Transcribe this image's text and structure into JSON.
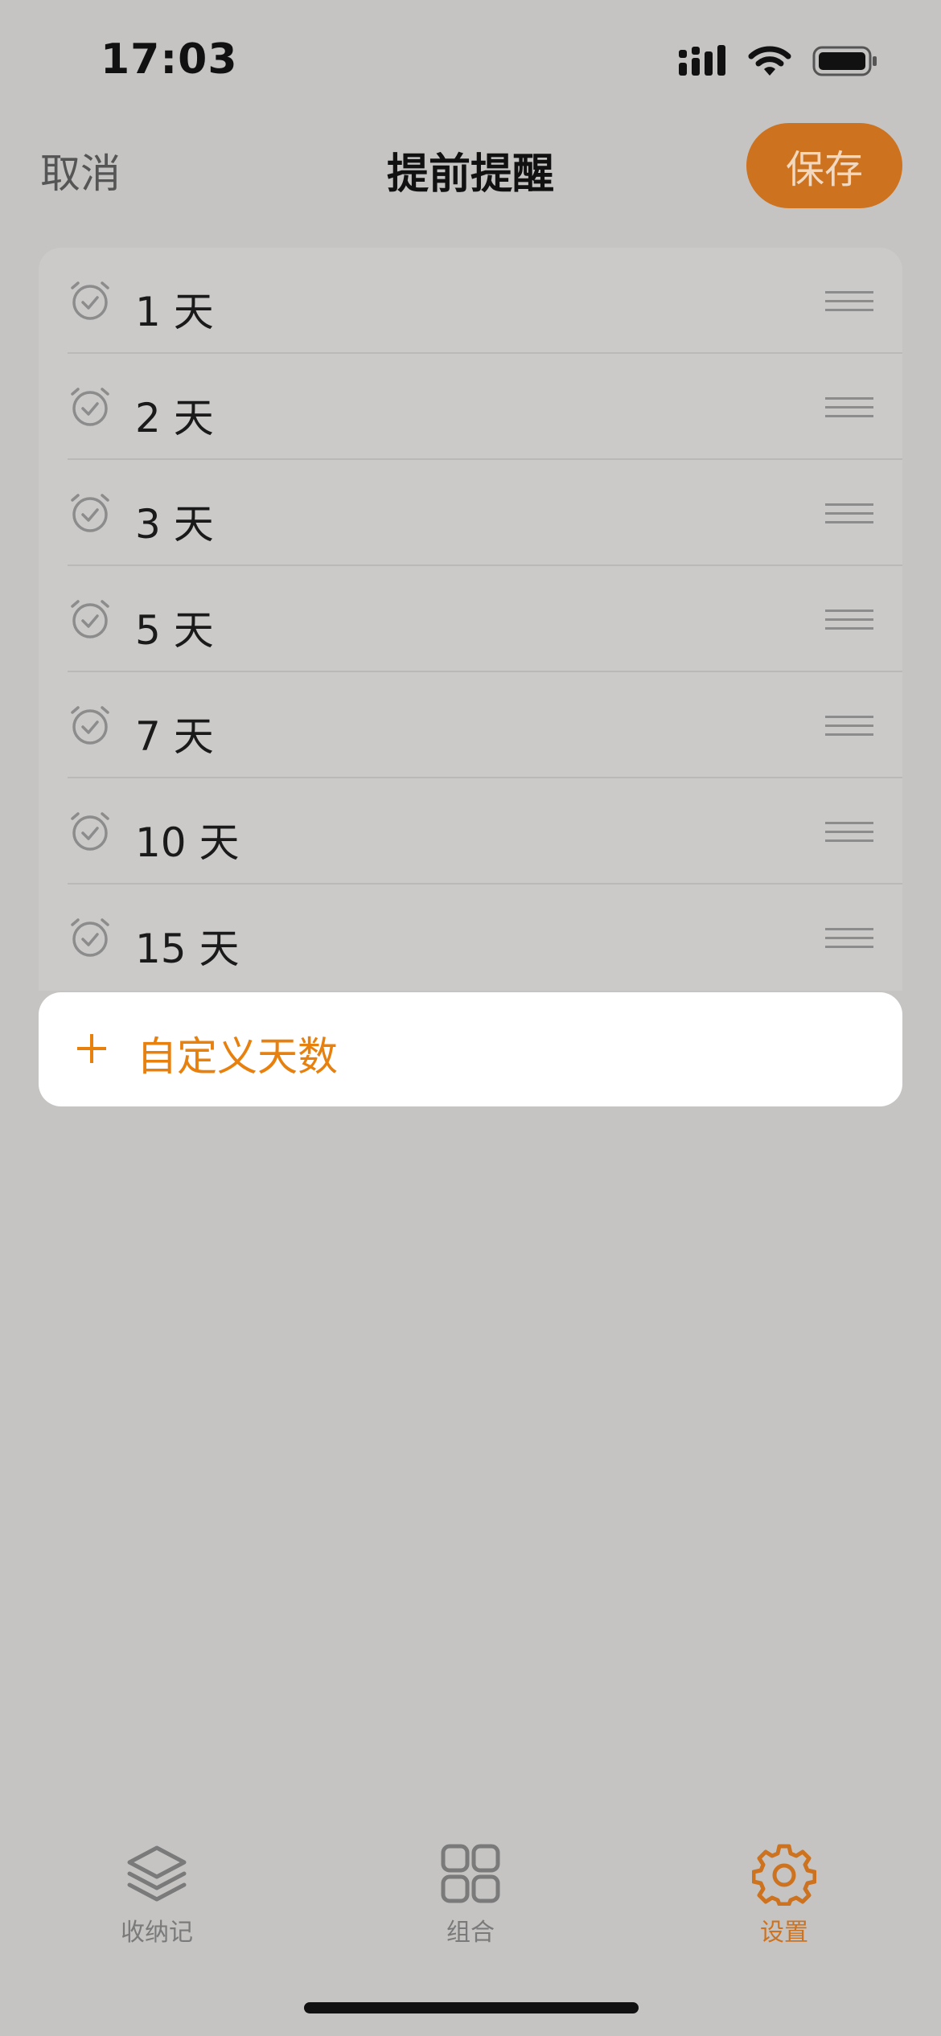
{
  "status_bar": {
    "time": "17:03"
  },
  "nav": {
    "cancel_label": "取消",
    "title": "提前提醒",
    "save_label": "保存"
  },
  "reminders": [
    {
      "label": "1 天"
    },
    {
      "label": "2 天"
    },
    {
      "label": "3 天"
    },
    {
      "label": "5 天"
    },
    {
      "label": "7 天"
    },
    {
      "label": "10 天"
    },
    {
      "label": "15 天"
    }
  ],
  "add_custom": {
    "label": "自定义天数",
    "icon": "plus-icon"
  },
  "tabs": [
    {
      "label": "收纳记",
      "icon": "layers-icon",
      "active": false
    },
    {
      "label": "组合",
      "icon": "grid-icon",
      "active": false
    },
    {
      "label": "设置",
      "icon": "gear-icon",
      "active": true
    }
  ],
  "colors": {
    "accent": "#cd721e",
    "add_accent": "#e8800e",
    "background": "#c5c4c3",
    "list_background": "#cbcac9"
  }
}
